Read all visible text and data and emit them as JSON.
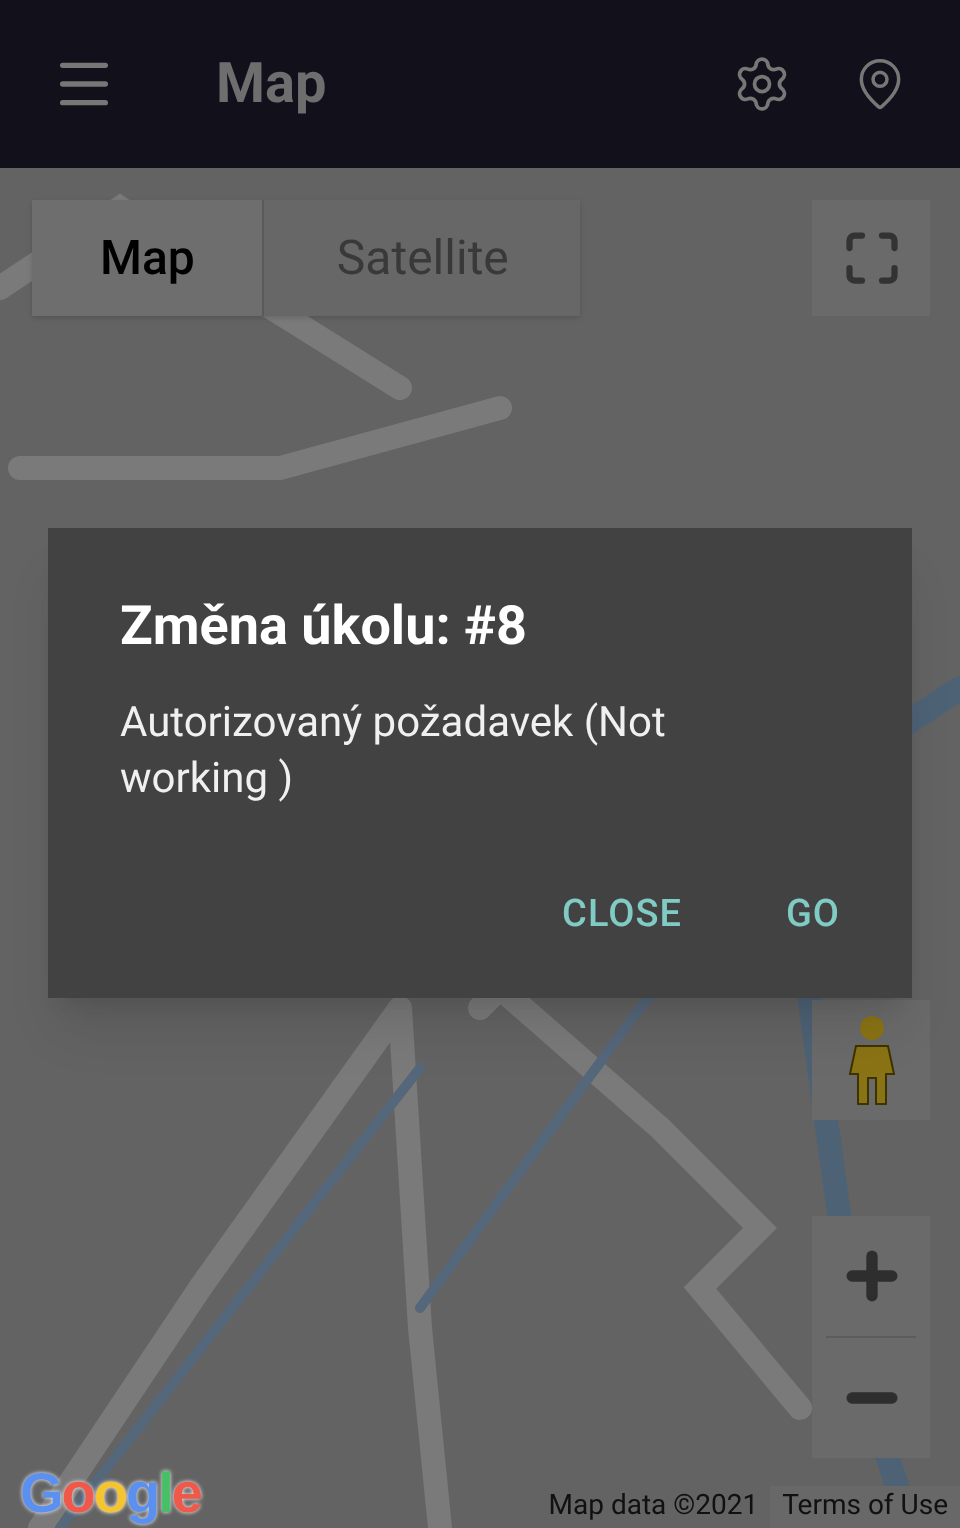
{
  "app_bar": {
    "title": "Map"
  },
  "map_type_tabs": [
    {
      "label": "Map",
      "selected": true
    },
    {
      "label": "Satellite",
      "selected": false
    }
  ],
  "map_footer": {
    "logo": "Google",
    "attribution": "Map data ©2021",
    "terms_link": "Terms of Use"
  },
  "dialog": {
    "title": "Změna úkolu: #8",
    "message": "Autorizovaný požadavek (Not working )",
    "buttons": [
      "CLOSE",
      "GO"
    ]
  }
}
